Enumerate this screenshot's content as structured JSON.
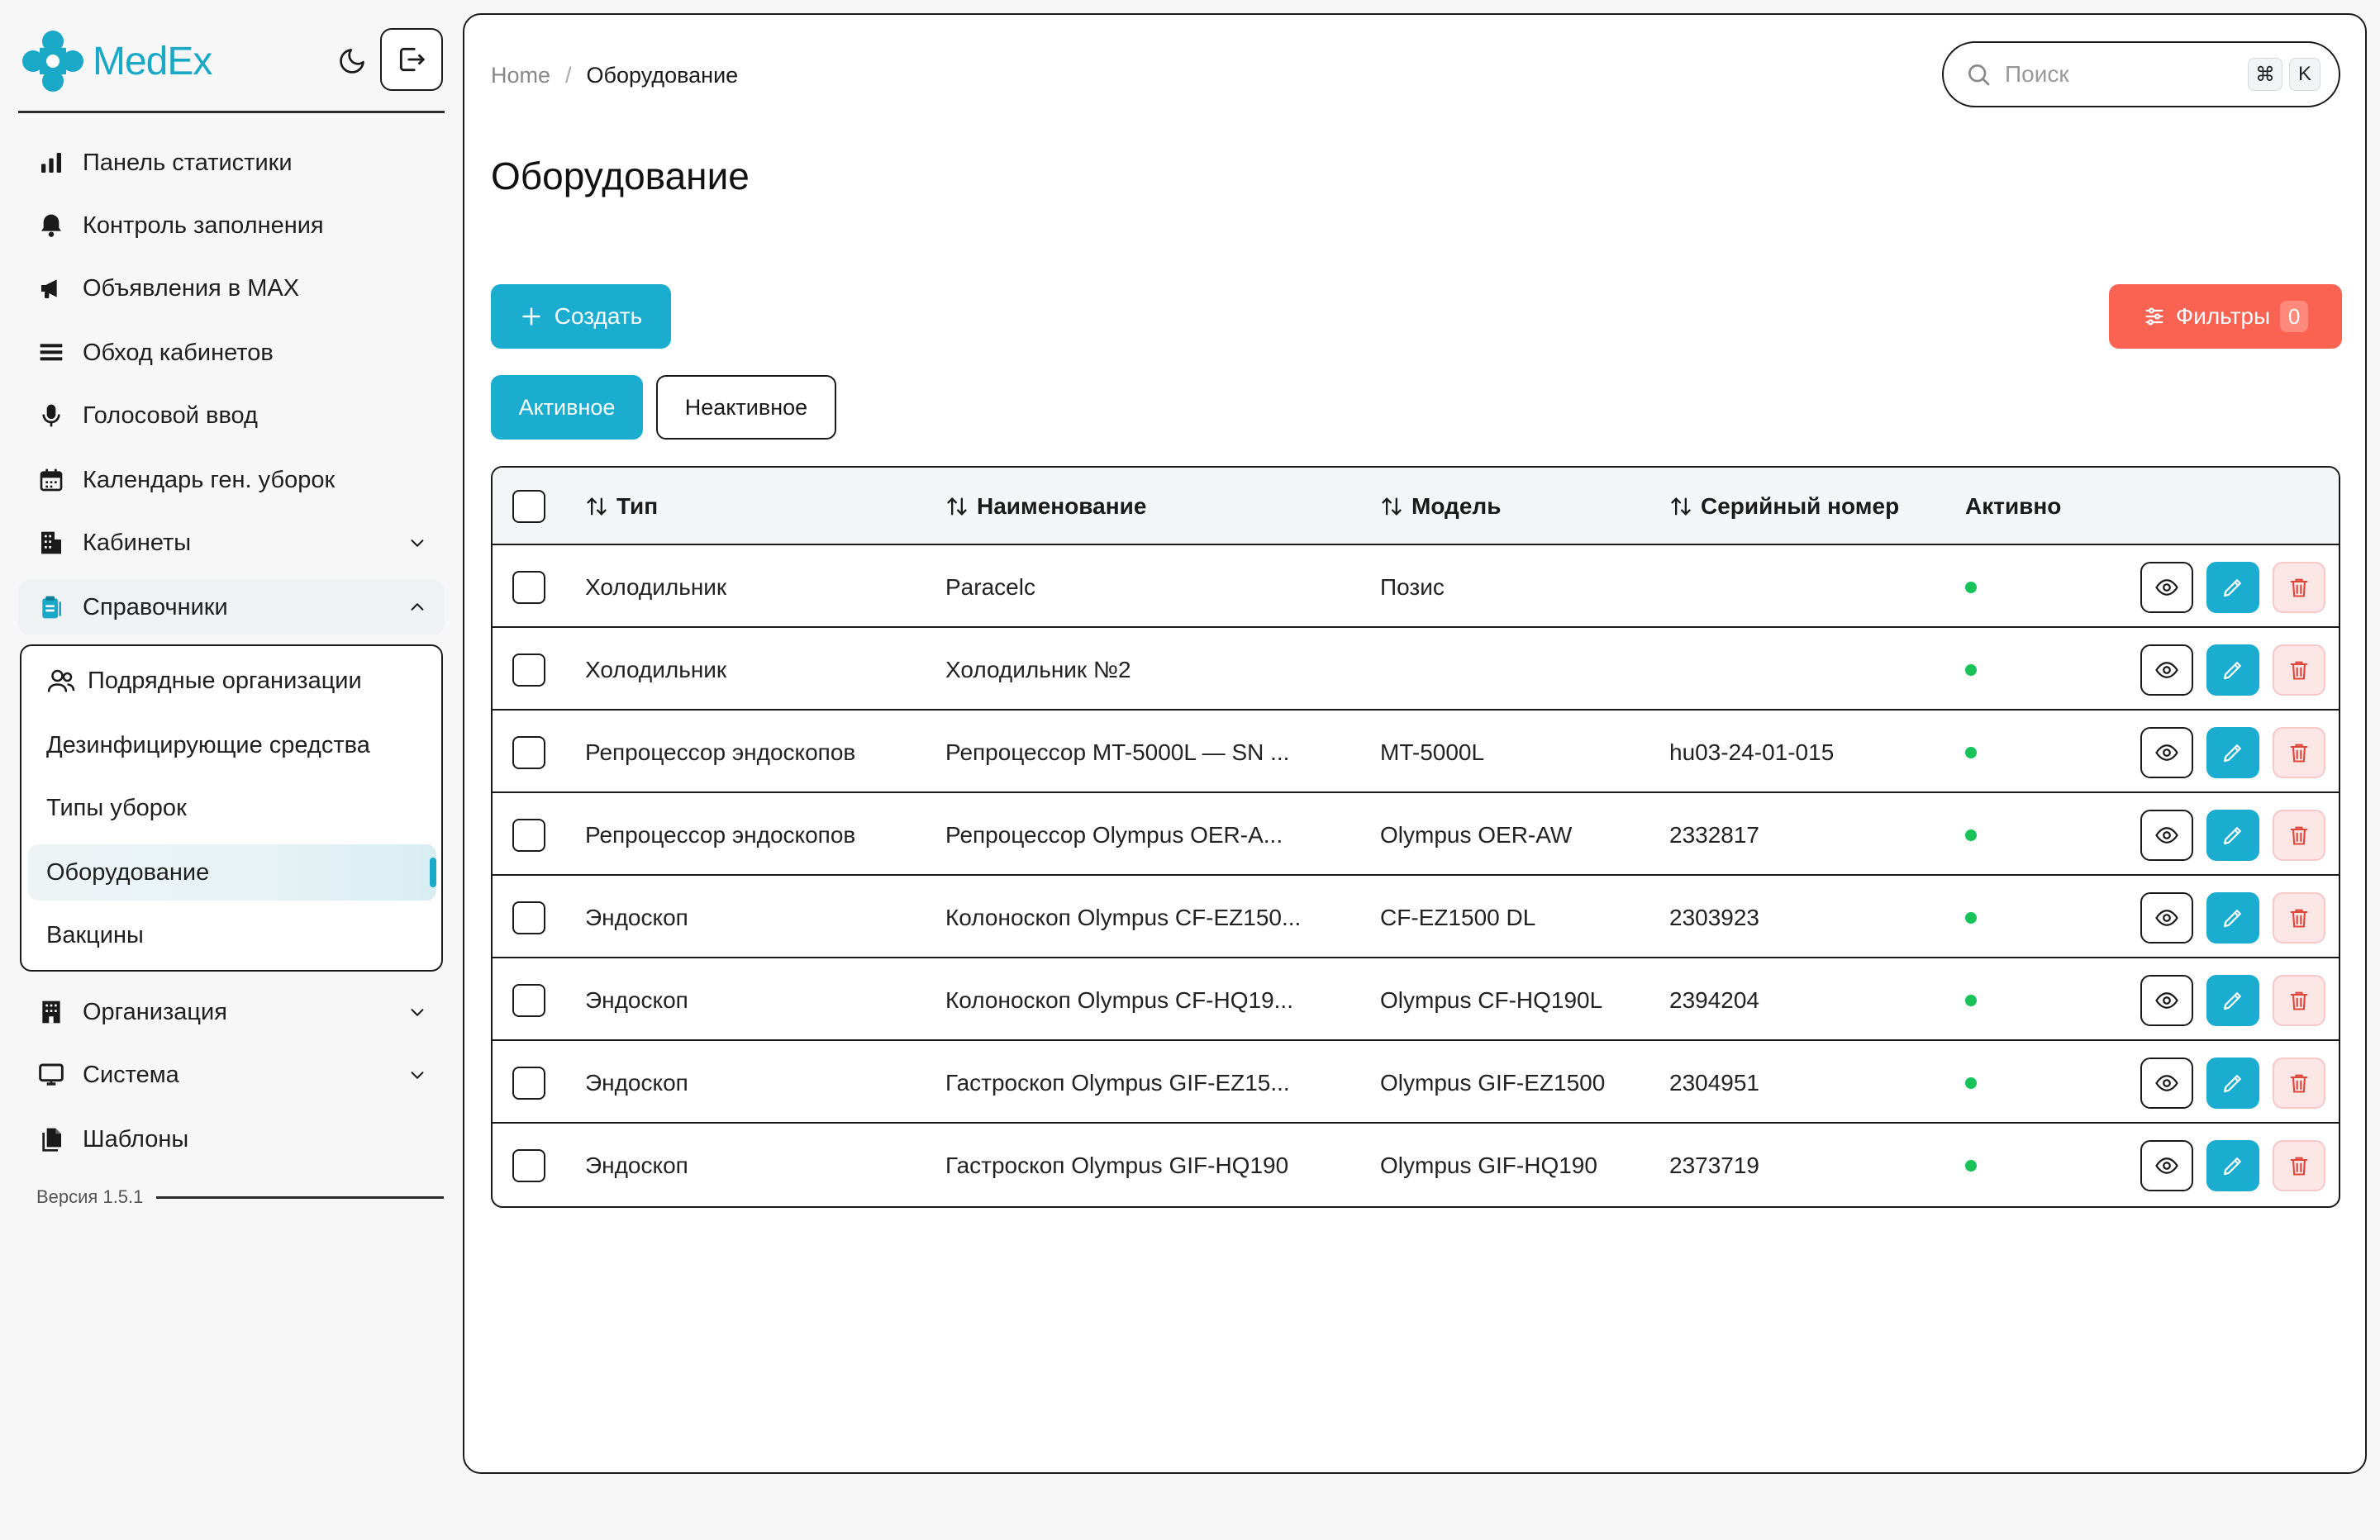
{
  "app": {
    "name": "MedEx"
  },
  "sidebar": {
    "items": [
      {
        "label": "Панель статистики",
        "icon": "bar-chart-icon"
      },
      {
        "label": "Контроль заполнения",
        "icon": "bell-icon"
      },
      {
        "label": "Объявления в MAX",
        "icon": "megaphone-icon"
      },
      {
        "label": "Обход кабинетов",
        "icon": "list-icon"
      },
      {
        "label": "Голосовой ввод",
        "icon": "microphone-icon"
      },
      {
        "label": "Календарь ген. уборок",
        "icon": "calendar-icon"
      },
      {
        "label": "Кабинеты",
        "icon": "building-icon"
      },
      {
        "label": "Справочники",
        "icon": "clipboard-icon"
      },
      {
        "label": "Организация",
        "icon": "building-icon"
      },
      {
        "label": "Система",
        "icon": "monitor-icon"
      },
      {
        "label": "Шаблоны",
        "icon": "documents-icon"
      }
    ],
    "sub_items": [
      {
        "label": "Подрядные организации",
        "icon": "users-icon"
      },
      {
        "label": "Дезинфицирующие средства"
      },
      {
        "label": "Типы уборок"
      },
      {
        "label": "Оборудование",
        "active": true
      },
      {
        "label": "Вакцины"
      }
    ],
    "version": "Версия 1.5.1"
  },
  "breadcrumb": {
    "home": "Home",
    "sep": "/",
    "current": "Оборудование"
  },
  "search": {
    "placeholder": "Поиск",
    "key1": "⌘",
    "key2": "K"
  },
  "page": {
    "title": "Оборудование"
  },
  "toolbar": {
    "create_label": "Создать",
    "filters_label": "Фильтры",
    "filters_count": "0"
  },
  "tabs": {
    "active": "Активное",
    "inactive": "Неактивное"
  },
  "table": {
    "columns": [
      "Тип",
      "Наименование",
      "Модель",
      "Серийный номер",
      "Активно"
    ],
    "rows": [
      {
        "type": "Холодильник",
        "name": "Paracelc",
        "model": "Позис",
        "serial": "",
        "active": true
      },
      {
        "type": "Холодильник",
        "name": "Холодильник №2",
        "model": "",
        "serial": "",
        "active": true
      },
      {
        "type": "Репроцессор эндоскопов",
        "name": "Репроцессор MT-5000L — SN ...",
        "model": "MT-5000L",
        "serial": "hu03-24-01-015",
        "active": true
      },
      {
        "type": "Репроцессор эндоскопов",
        "name": "Репроцессор Olympus OER-A...",
        "model": "Olympus OER-AW",
        "serial": "2332817",
        "active": true
      },
      {
        "type": "Эндоскоп",
        "name": "Колоноскоп Olympus CF-EZ150...",
        "model": "CF-EZ1500 DL",
        "serial": "2303923",
        "active": true
      },
      {
        "type": "Эндоскоп",
        "name": "Колоноскоп Olympus CF-HQ19...",
        "model": "Olympus CF-HQ190L",
        "serial": "2394204",
        "active": true
      },
      {
        "type": "Эндоскоп",
        "name": "Гастроскоп Olympus GIF-EZ15...",
        "model": "Olympus GIF-EZ1500",
        "serial": "2304951",
        "active": true
      },
      {
        "type": "Эндоскоп",
        "name": "Гастроскоп Olympus GIF-HQ190",
        "model": "Olympus GIF-HQ190",
        "serial": "2373719",
        "active": true
      }
    ]
  },
  "colors": {
    "accent": "#1aadd0",
    "filters": "#fa6251",
    "active_dot": "#18c45a"
  }
}
